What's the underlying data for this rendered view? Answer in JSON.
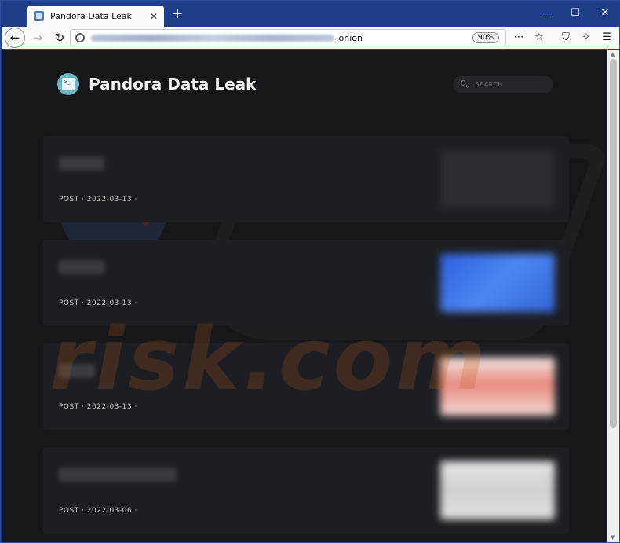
{
  "browser": {
    "tab_title": "Pandora Data Leak",
    "tab_close": "✕",
    "new_tab": "+",
    "window_controls": {
      "minimize": "—",
      "maximize": "☐",
      "close": "✕"
    },
    "url_tld": ".onion",
    "zoom": "90%"
  },
  "site": {
    "title": "Pandora Data Leak",
    "search_placeholder": "SEARCH"
  },
  "posts": [
    {
      "meta": "POST · 2022-03-13 ·",
      "thumb_color": "#2b2d33"
    },
    {
      "meta": "POST · 2022-03-13 ·",
      "thumb_color": "#3a6fe0"
    },
    {
      "meta": "POST · 2022-03-13 ·",
      "thumb_color": "#e9c2bd"
    },
    {
      "meta": "POST · 2022-03-06 ·",
      "thumb_color": "#d9d9d9"
    }
  ],
  "watermark": {
    "text": "risk.com"
  },
  "colors": {
    "page_bg": "#15171b",
    "card_bg": "#1c1e23",
    "chrome_blue": "#1d3d86"
  }
}
